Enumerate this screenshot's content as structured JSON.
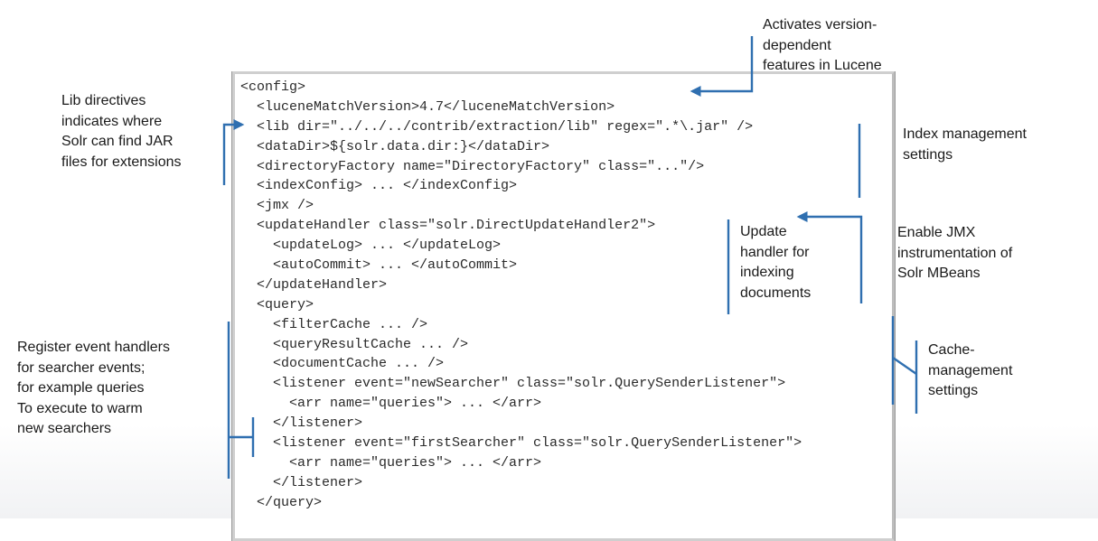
{
  "code_lines": [
    "<config>",
    "  <luceneMatchVersion>4.7</luceneMatchVersion>",
    "  <lib dir=\"../../../contrib/extraction/lib\" regex=\".*\\.jar\" />",
    "  <dataDir>${solr.data.dir:}</dataDir>",
    "  <directoryFactory name=\"DirectoryFactory\" class=\"...\"/>",
    "  <indexConfig> ... </indexConfig>",
    "  <jmx />",
    "  <updateHandler class=\"solr.DirectUpdateHandler2\">",
    "    <updateLog> ... </updateLog>",
    "    <autoCommit> ... </autoCommit>",
    "  </updateHandler>",
    "  <query>",
    "    <filterCache ... />",
    "    <queryResultCache ... />",
    "    <documentCache ... />",
    "    <listener event=\"newSearcher\" class=\"solr.QuerySenderListener\">",
    "      <arr name=\"queries\"> ... </arr>",
    "    </listener>",
    "    <listener event=\"firstSearcher\" class=\"solr.QuerySenderListener\">",
    "      <arr name=\"queries\"> ... </arr>",
    "    </listener>",
    "  </query>"
  ],
  "annotations": {
    "version": "Activates version-\ndependent\nfeatures in Lucene",
    "lib": "Lib directives\nindicates where\nSolr can find JAR\nfiles for extensions",
    "index": "Index management\nsettings",
    "update": "Update\nhandler for\nindexing\ndocuments",
    "jmx": "Enable JMX\ninstrumentation of\nSolr MBeans",
    "events": "Register event handlers\nfor searcher events;\nfor example queries\nTo execute to warm\nnew searchers",
    "cache": "Cache-\nmanagement\nsettings"
  },
  "colors": {
    "arrow": "#2f6fb0",
    "code_text": "#2a2a2a",
    "label_text": "#1a1a1a"
  }
}
